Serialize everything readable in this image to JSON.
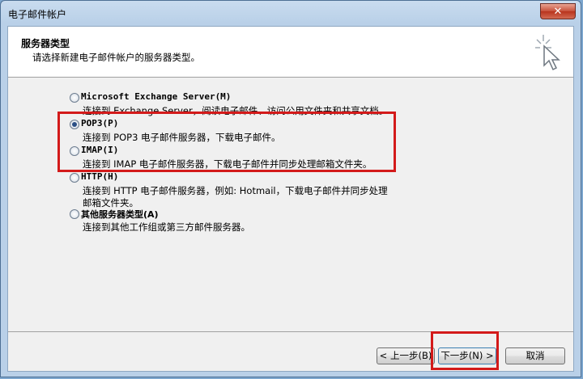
{
  "window": {
    "title": "电子邮件帐户",
    "close_label": "✕"
  },
  "header": {
    "title": "服务器类型",
    "subtitle": "请选择新建电子邮件帐户的服务器类型。"
  },
  "options": [
    {
      "label": "Microsoft Exchange Server(M)",
      "desc": "连接到 Exchange Server，阅读电子邮件、访问公用文件夹和共享文档。",
      "checked": false
    },
    {
      "label": "POP3(P)",
      "desc": "连接到 POP3 电子邮件服务器，下载电子邮件。",
      "checked": true
    },
    {
      "label": "IMAP(I)",
      "desc": "连接到 IMAP 电子邮件服务器，下载电子邮件并同步处理邮箱文件夹。",
      "checked": false
    },
    {
      "label": "HTTP(H)",
      "desc": "连接到 HTTP 电子邮件服务器，例如: Hotmail，下载电子邮件并同步处理",
      "desc2": "邮箱文件夹。",
      "checked": false
    },
    {
      "label": "其他服务器类型(A)",
      "desc": "连接到其他工作组或第三方邮件服务器。",
      "checked": false
    }
  ],
  "buttons": {
    "back": "< 上一步(B)",
    "next": "下一步(N) >",
    "cancel": "取消"
  },
  "colors": {
    "highlight": "#d31a1a"
  }
}
